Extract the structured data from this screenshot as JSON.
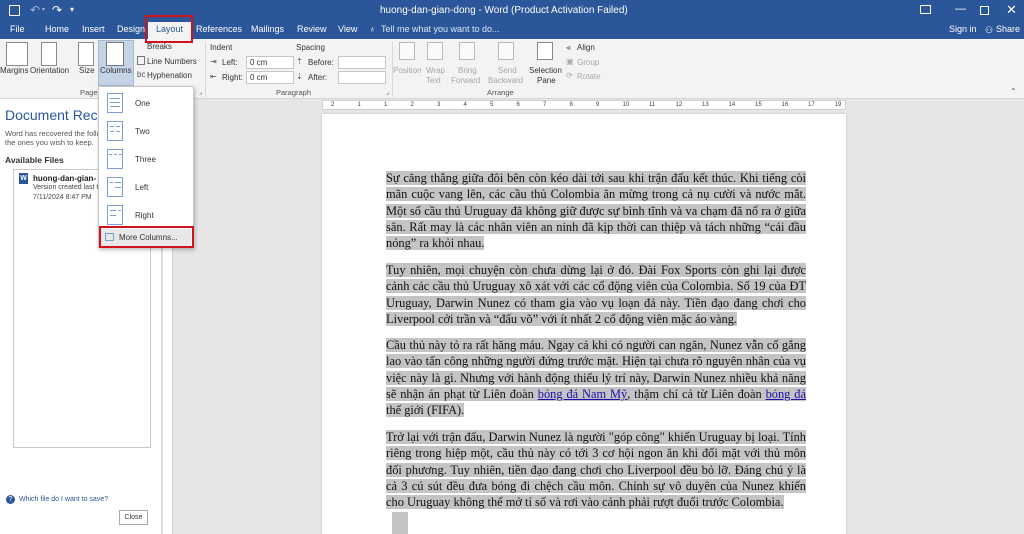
{
  "window": {
    "title": "huong-dan-gian-dong - Word (Product Activation Failed)",
    "tell_me": "Tell me what you want to do...",
    "sign_in": "Sign in",
    "share": "Share"
  },
  "tabs": [
    "File",
    "Home",
    "Insert",
    "Design",
    "Layout",
    "References",
    "Mailings",
    "Review",
    "View"
  ],
  "active_tab": "Layout",
  "ribbon": {
    "page_setup": {
      "margins": "Margins",
      "orientation": "Orientation",
      "size": "Size",
      "columns": "Columns",
      "breaks": "Breaks",
      "line_numbers": "Line Numbers",
      "hyphenation": "Hyphenation",
      "group_label": "Page S"
    },
    "paragraph": {
      "indent_title": "Indent",
      "left_label": "Left:",
      "left_value": "0 cm",
      "right_label": "Right:",
      "right_value": "0 cm",
      "spacing_title": "Spacing",
      "before_label": "Before:",
      "after_label": "After:",
      "group_label": "Paragraph"
    },
    "arrange": {
      "position": [
        "Position"
      ],
      "wrap_text": [
        "Wrap",
        "Text"
      ],
      "bring_forward": [
        "Bring",
        "Forward"
      ],
      "send_backward": [
        "Send",
        "Backward"
      ],
      "selection_pane": [
        "Selection",
        "Pane"
      ],
      "align": "Align",
      "group": "Group",
      "rotate": "Rotate",
      "group_label": "Arrange"
    }
  },
  "columns_menu": {
    "items": [
      "One",
      "Two",
      "Three",
      "Left",
      "Right"
    ],
    "more": "More Columns..."
  },
  "recovery_pane": {
    "title": "Document Reco",
    "desc_line1": "Word has recovered the follo",
    "desc_line2": "the ones you wish to keep.",
    "available_files": "Available Files",
    "file_name": "huong-dan-gian-",
    "file_status": "Version created last t",
    "file_date": "7/11/2024 8:47 PM",
    "help_link": "Which file do I want to save?",
    "close_button": "Close"
  },
  "ruler": {
    "ticks": [
      "2",
      "1",
      "1",
      "2",
      "3",
      "4",
      "5",
      "6",
      "7",
      "8",
      "9",
      "10",
      "11",
      "12",
      "13",
      "14",
      "15",
      "16",
      "17",
      "19"
    ]
  },
  "document": {
    "p1": "Sự căng thẳng giữa đôi bên còn kéo dài tới sau khi trận đấu kết thúc. Khi tiếng còi mãn cuộc vang lên, các cầu thủ Colombia ăn mừng trong cả nụ cười và nước mắt. Một số cầu thủ Uruguay đã không giữ được sự bình tĩnh và va chạm đã nổ ra ở giữa sân. Rất may là các nhân viên an ninh đã kịp thời can thiệp và tách những “cái đầu nóng” ra khỏi nhau.",
    "p2": "Tuy nhiên, mọi chuyện còn chưa dừng lại ở đó. Đài Fox Sports còn ghi lại được cảnh các cầu thủ Uruguay xô xát với các cổ động viên của Colombia. Số 19 của ĐT Uruguay, Darwin Nunez có tham gia vào vụ loạn đả này. Tiền đạo đang chơi cho Liverpool cởi trần và “đấu võ” với ít nhất 2 cổ động viên mặc áo vàng.",
    "p3a": "Cầu thủ này tỏ ra rất hăng máu. Ngay cả khi có người can ngăn, Nunez vẫn cố gắng lao vào tấn công những người đứng trước mặt. Hiện tại chưa rõ nguyên nhân của vụ việc này là gì. Nhưng với hành động thiếu lý trí này, Darwin Nunez nhiều khả năng sẽ nhận án phạt từ Liên đoàn ",
    "p3_link1": "bóng đá Nam Mỹ",
    "p3b": ", thậm chí cả từ Liên đoàn ",
    "p3_link2": "bóng đá",
    "p3c": " thế giới (FIFA).",
    "p4": "Trở lại với trận đấu, Darwin Nunez là người \"góp công\" khiến Uruguay bị loại. Tính riêng trong hiệp một, cầu thủ này có tới 3 cơ hội ngon ăn khi đối mặt với thủ môn đối phương. Tuy nhiên, tiền đạo đang chơi cho Liverpool đều bỏ lỡ. Đáng chú ý là cả 3 cú sút đều đưa bóng đi chệch cầu môn. Chính sự vô duyên của Nunez khiến cho Uruguay không thể mở tỉ số và rơi vào cảnh phải rượt đuổi trước Colombia."
  },
  "colors": {
    "title_bar": "#2b579a",
    "highlight": "#c4c4c4",
    "annotation": "#d0121b",
    "link": "#1a0dab"
  }
}
